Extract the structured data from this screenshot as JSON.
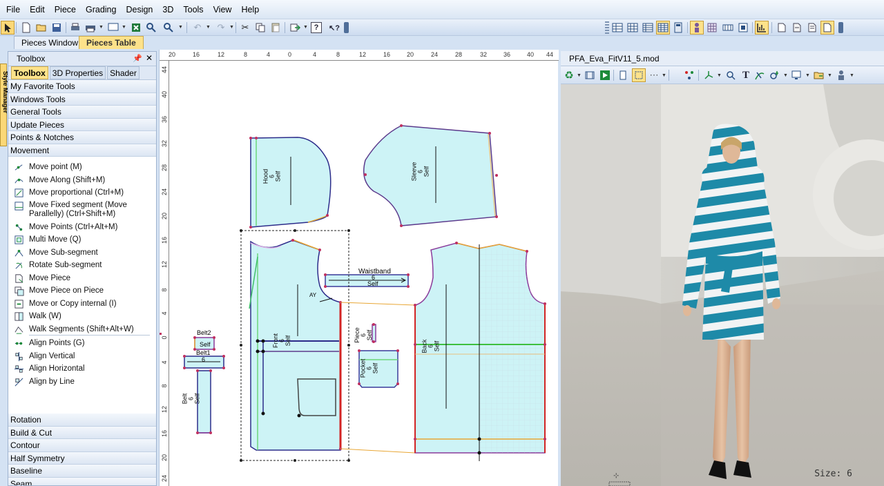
{
  "menu": [
    "File",
    "Edit",
    "Piece",
    "Grading",
    "Design",
    "3D",
    "Tools",
    "View",
    "Help"
  ],
  "doc_tabs": {
    "pieces_window": "Pieces Window",
    "pieces_table": "Pieces Table"
  },
  "side_tab": "Style Manager",
  "toolbox": {
    "title": "Toolbox",
    "tabs": [
      "Toolbox",
      "3D Properties",
      "Shader"
    ],
    "categories_top": [
      "My Favorite Tools",
      "Windows Tools",
      "General Tools",
      "Update Pieces",
      "Points & Notches",
      "Movement"
    ],
    "tools": [
      "Move point (M)",
      "Move Along (Shift+M)",
      "Move proportional (Ctrl+M)",
      "Move Fixed segment (Move\nParallelly) (Ctrl+Shift+M)",
      "Move Points (Ctrl+Alt+M)",
      "Multi Move (Q)",
      "Move Sub-segment",
      "Rotate Sub-segment",
      "Move Piece",
      "Move Piece on Piece",
      "Move or Copy internal (I)",
      "Walk (W)",
      "Walk Segments (Shift+Alt+W)",
      "Align Points (G)",
      "Align Vertical",
      "Align Horizontal",
      "Align by Line"
    ],
    "categories_bottom": [
      "Rotation",
      "Build & Cut",
      "Contour",
      "Half Symmetry",
      "Baseline",
      "Seam"
    ]
  },
  "ruler_top": [
    "20",
    "16",
    "12",
    "8",
    "4",
    "0",
    "4",
    "8",
    "12",
    "16",
    "20",
    "24",
    "28",
    "32",
    "36",
    "40",
    "44",
    "48"
  ],
  "ruler_left": [
    "44",
    "40",
    "36",
    "32",
    "28",
    "24",
    "20",
    "16",
    "12",
    "8",
    "4",
    "0",
    "4",
    "8",
    "12",
    "16",
    "20",
    "24"
  ],
  "pieces": {
    "hood": "Hood\n6\nSelf",
    "sleeve": "Sleeve\n6\nSelf",
    "waistband_name": "Waistband",
    "waistband_size": "6",
    "waistband_self": "Self",
    "front": "Front\n6\nSelf",
    "back": "Back\n6\nSelf",
    "piece": "Piece\n6\nSelf",
    "pocket": "Pocket\n6\nSelf",
    "belt2": "Belt2",
    "belt2_self": "Self",
    "belt1": "Belt1",
    "belt1_self": "6",
    "belt": "Belt\n6\nSelf",
    "ay_label": "AY"
  },
  "view3d": {
    "title": "PFA_Eva_FitV11_5.mod",
    "size_label": "Size: 6"
  },
  "colors": {
    "piece_fill": "#cdf3f6",
    "accent_tab": "#fde28a",
    "garment_stripe": "#1e8aa8"
  }
}
